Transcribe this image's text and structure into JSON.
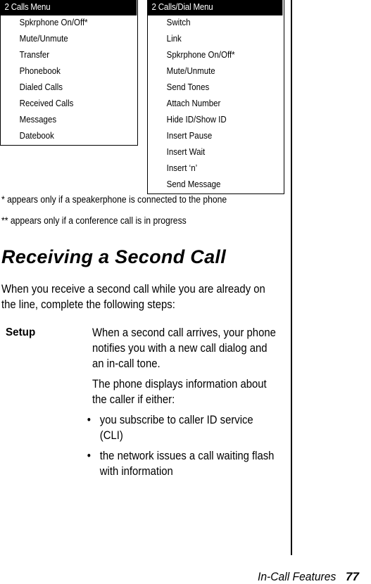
{
  "menus": {
    "two_calls": {
      "title": "2 Calls Menu",
      "items": [
        "Spkrphone On/Off*",
        "Mute/Unmute",
        "Transfer",
        "Phonebook",
        "Dialed Calls",
        "Received Calls",
        "Messages",
        "Datebook"
      ]
    },
    "two_calls_dial": {
      "title": "2 Calls/Dial Menu",
      "items": [
        "Switch",
        "Link",
        "Spkrphone On/Off*",
        "Mute/Unmute",
        "Send Tones",
        "Attach Number",
        "Hide ID/Show ID",
        "Insert Pause",
        "Insert Wait",
        "Insert ‘n’",
        "Send Message"
      ]
    }
  },
  "footnotes": {
    "single_star": "* appears only if a speakerphone is connected to the phone",
    "double_star": "** appears only if a conference call is in progress"
  },
  "section": {
    "title": "Receiving a Second Call",
    "intro": "When you receive a second call while you are already on the line, complete the following steps:",
    "steps": [
      {
        "label": "Setup",
        "paragraphs": [
          "When a second call arrives, your phone notifies you with a new call dialog and an in-call tone.",
          "The phone displays information about the caller if either:"
        ],
        "bullet_char": "•",
        "bullets": [
          "you subscribe to caller ID service (CLI)",
          "the network issues a call waiting flash with information"
        ]
      }
    ]
  },
  "footer": {
    "section_name": "In-Call Features",
    "page_number": "77"
  }
}
